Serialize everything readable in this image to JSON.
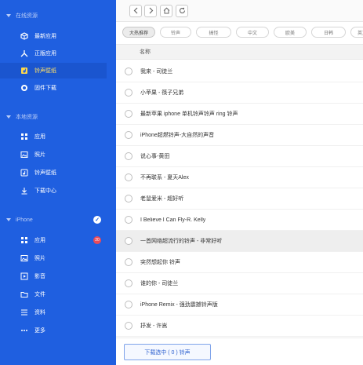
{
  "sidebar": {
    "sections": [
      {
        "label": "在线资源"
      },
      {
        "label": "本地资源"
      },
      {
        "label": "iPhone"
      }
    ],
    "items": [
      {
        "label": "最新应用",
        "icon": "cube-icon"
      },
      {
        "label": "正版应用",
        "icon": "tools-icon"
      },
      {
        "label": "铃声壁纸",
        "icon": "music-icon"
      },
      {
        "label": "固件下载",
        "icon": "refresh-icon"
      },
      {
        "label": "应用",
        "icon": "grid-icon"
      },
      {
        "label": "照片",
        "icon": "image-icon"
      },
      {
        "label": "铃声壁纸",
        "icon": "music-box-icon"
      },
      {
        "label": "下载中心",
        "icon": "download-icon"
      },
      {
        "label": "应用",
        "icon": "grid-icon"
      },
      {
        "label": "照片",
        "icon": "image-icon"
      },
      {
        "label": "影音",
        "icon": "video-icon"
      },
      {
        "label": "文件",
        "icon": "folder-icon"
      },
      {
        "label": "资料",
        "icon": "list-icon"
      },
      {
        "label": "更多",
        "icon": "more-icon"
      }
    ],
    "device_badge": "✓",
    "apps_count": "20",
    "accent": "#1f5fe0"
  },
  "toolbar": {
    "back_icon": "chevron-left-icon",
    "forward_icon": "chevron-right-icon",
    "home_icon": "home-icon",
    "refresh_icon": "refresh-icon"
  },
  "chips": [
    "大热推荐",
    "铃声",
    "搞怪",
    "中文",
    "欧美",
    "日韩",
    "英文"
  ],
  "table": {
    "header": "名称",
    "rows": [
      "我来 - 司徒兰",
      "小苹果 - 筷子兄弟",
      "最新苹果 iphone 单机铃声铃声 ring 铃声",
      "iPhone超燃铃声-大自然的声音",
      "说心事-黄田",
      "不再联系 - 夏天Alex",
      "老鼠爱米 - 超好听",
      "I Believe I Can Fly-R. Kelly",
      "一首网络超流行的铃声 - 非常好听",
      "突然想起你 铃声",
      "谁的你 - 司徒兰",
      "iPhone Remix - 强劲震撼铃声版",
      "抒发 - 许嵩"
    ],
    "highlighted_row": 8
  },
  "download_button": "下载选中 ( 0 ) 铃声"
}
